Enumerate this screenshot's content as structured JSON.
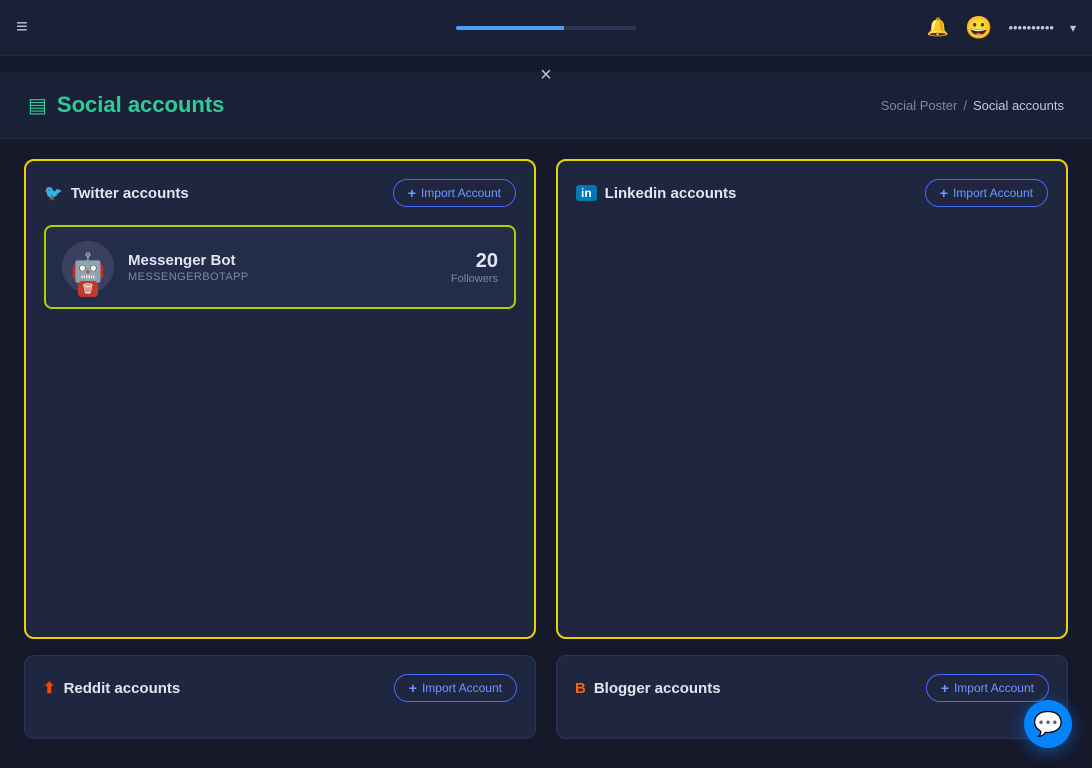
{
  "navbar": {
    "hamburger_icon": "≡",
    "bell_icon": "🔔",
    "avatar_emoji": "😀",
    "username": "••••••••••",
    "dropdown_icon": "▾"
  },
  "close_button": "×",
  "page": {
    "title": "Social accounts",
    "title_icon": "▤",
    "breadcrumb": {
      "parent": "Social Poster",
      "separator": "/",
      "current": "Social accounts"
    }
  },
  "twitter_card": {
    "title": "Twitter accounts",
    "icon": "🐦",
    "import_button": "+ Import Account",
    "account": {
      "name": "Messenger Bot",
      "handle": "MESSENGERBOTAPP",
      "followers_count": "20",
      "followers_label": "Followers",
      "avatar_emoji": "🤖",
      "delete_icon": "🗑"
    }
  },
  "linkedin_card": {
    "title": "Linkedin accounts",
    "icon": "in",
    "import_button": "+ Import Account"
  },
  "reddit_card": {
    "title": "Reddit accounts",
    "icon": "⬆",
    "import_button": "+ Import Account"
  },
  "blogger_card": {
    "title": "Blogger accounts",
    "icon": "B",
    "import_button": "+ Import Account"
  },
  "messenger_bubble": {
    "icon": "💬"
  },
  "colors": {
    "accent_yellow": "#e8d500",
    "accent_green": "#2ecc97",
    "accent_blue": "#4a6aff"
  }
}
